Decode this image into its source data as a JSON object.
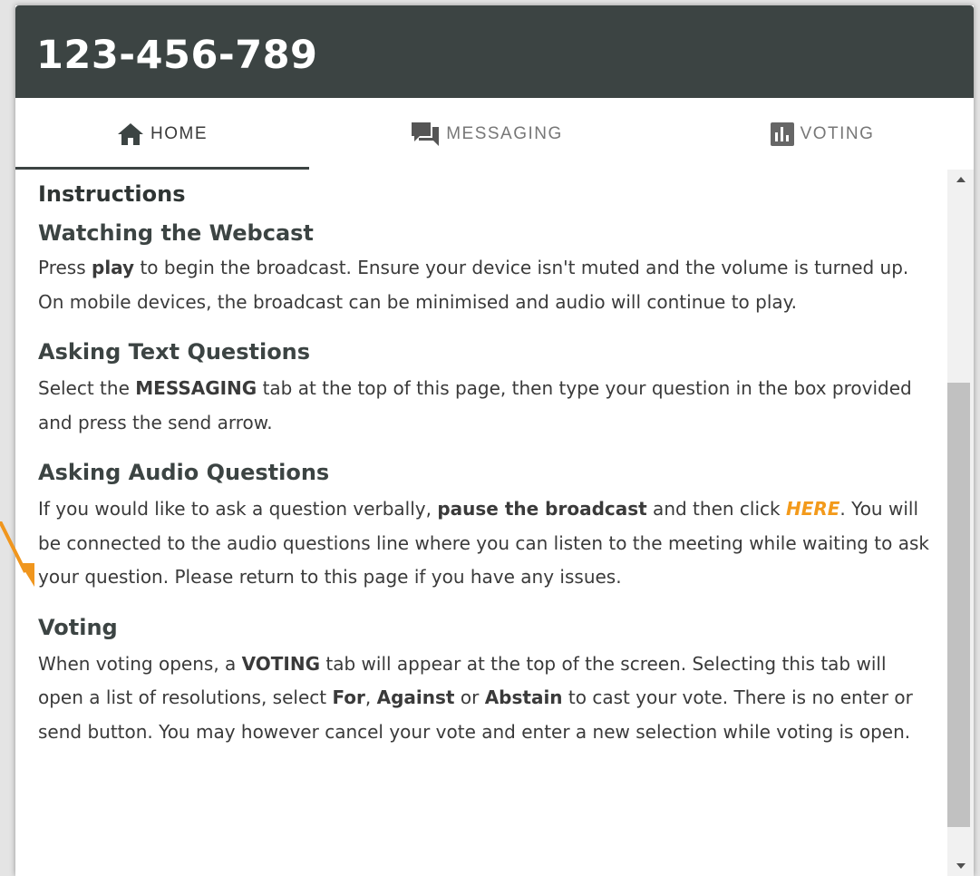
{
  "header": {
    "title": "123-456-789"
  },
  "tabs": [
    {
      "label": "HOME",
      "icon": "home-icon",
      "active": true
    },
    {
      "label": "MESSAGING",
      "icon": "chat-icon",
      "active": false
    },
    {
      "label": "VOTING",
      "icon": "bar-chart-icon",
      "active": false
    }
  ],
  "content": {
    "heading": "Instructions",
    "sections": {
      "webcast": {
        "title": "Watching the Webcast",
        "t1": "Press ",
        "b1": "play",
        "t2": " to begin the broadcast. Ensure your device isn't muted and the volume is turned up. On mobile devices, the broadcast can be minimised and audio will continue to play."
      },
      "text_questions": {
        "title": "Asking Text Questions",
        "t1": "Select the ",
        "b1": "MESSAGING",
        "t2": " tab at the top of this page, then type your question in the box provided and press the send arrow."
      },
      "audio_questions": {
        "title": "Asking Audio Questions",
        "t1": "If you would like to ask a question verbally, ",
        "b1": "pause the broadcast",
        "t2": " and then click ",
        "link": "HERE",
        "t3": ". You will be connected to the audio questions line where you can listen to the meeting while waiting to ask your question. Please return to this page if you have any issues."
      },
      "voting": {
        "title": "Voting",
        "t1": "When voting opens, a ",
        "b1": "VOTING",
        "t2": " tab will appear at the top of the screen. Selecting this tab will open a list of resolutions, select ",
        "b2": "For",
        "t3": ", ",
        "b3": "Against",
        "t4": " or ",
        "b4": "Abstain",
        "t5": " to cast your vote. There is no enter or send button. You may however cancel your vote and enter a new selection while voting is open."
      }
    }
  },
  "colors": {
    "header_bg": "#3c4443",
    "link": "#f39a1b",
    "annotation_arrow": "#f0961e"
  }
}
